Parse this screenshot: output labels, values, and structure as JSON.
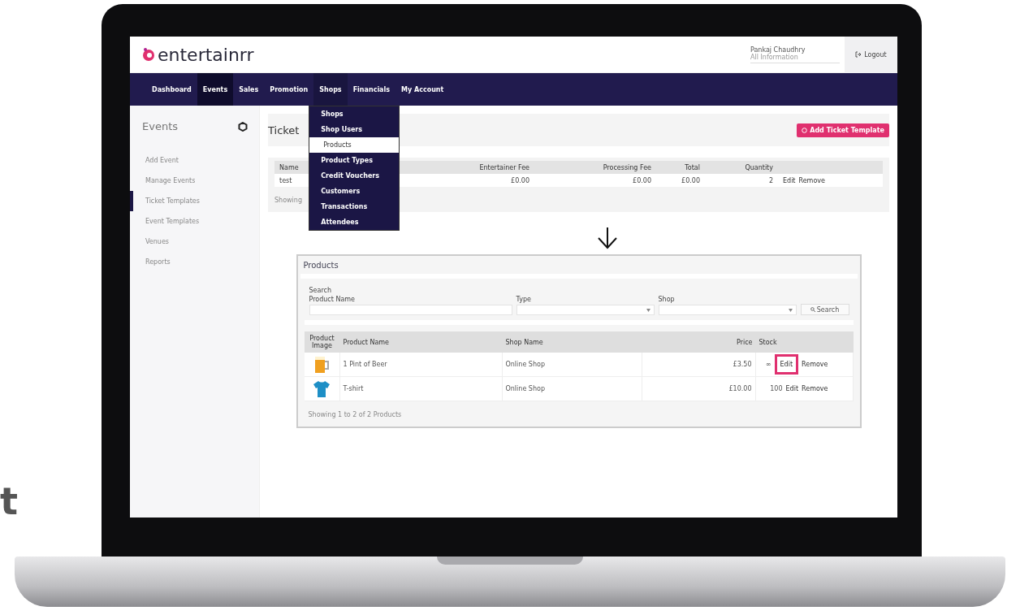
{
  "side_text": "t",
  "header": {
    "logo": "entertainrr",
    "user": {
      "name": "Pankaj Chaudhry",
      "account": "All Information"
    },
    "logout": "Logout"
  },
  "nav": [
    {
      "label": "Dashboard",
      "selected": false,
      "expanded": false
    },
    {
      "label": "Events",
      "selected": true,
      "expanded": false
    },
    {
      "label": "Sales",
      "selected": false,
      "expanded": false
    },
    {
      "label": "Promotion",
      "selected": false,
      "expanded": false
    },
    {
      "label": "Shops",
      "selected": false,
      "expanded": true
    },
    {
      "label": "Financials",
      "selected": false,
      "expanded": false
    },
    {
      "label": "My Account",
      "selected": false,
      "expanded": false
    }
  ],
  "dropdown": [
    {
      "label": "Shops",
      "selected": false
    },
    {
      "label": "Shop Users",
      "selected": false
    },
    {
      "label": "Products",
      "selected": true
    },
    {
      "label": "Product Types",
      "selected": false
    },
    {
      "label": "Credit Vouchers",
      "selected": false
    },
    {
      "label": "Customers",
      "selected": false
    },
    {
      "label": "Transactions",
      "selected": false
    },
    {
      "label": "Attendees",
      "selected": false
    }
  ],
  "sidebar": {
    "title": "Events",
    "items": [
      {
        "label": "Add Event",
        "selected": false
      },
      {
        "label": "Manage Events",
        "selected": false
      },
      {
        "label": "Ticket Templates",
        "selected": true
      },
      {
        "label": "Event Templates",
        "selected": false
      },
      {
        "label": "Venues",
        "selected": false
      },
      {
        "label": "Reports",
        "selected": false
      }
    ]
  },
  "page": {
    "title": "Ticket",
    "add_button": "Add Ticket Template",
    "table": {
      "columns": [
        "Name",
        "Entertainer Fee",
        "Processing Fee",
        "Total",
        "Quantity"
      ],
      "rows": [
        {
          "cells": [
            "test",
            "£0.00",
            "£0.00",
            "£0.00",
            "2"
          ],
          "actions": [
            "Edit",
            "Remove"
          ]
        }
      ],
      "footer": "Showing"
    }
  },
  "products": {
    "title": "Products",
    "search": {
      "heading": "Search",
      "name_label": "Product Name",
      "type_label": "Type",
      "shop_label": "Shop",
      "button": "Search"
    },
    "columns": [
      "Product Image",
      "Product Name",
      "Shop Name",
      "Price",
      "Stock"
    ],
    "rows": [
      {
        "kind": "mug",
        "name": "1 Pint of Beer",
        "shop": "Online Shop",
        "price": "£3.50",
        "stock": "∞",
        "actions": [
          {
            "label": "Edit",
            "highlighted": true
          },
          {
            "label": "Remove",
            "highlighted": false
          }
        ]
      },
      {
        "kind": "shirt",
        "name": "T-shirt",
        "shop": "Online Shop",
        "price": "£10.00",
        "stock": "100",
        "actions": [
          {
            "label": "Edit",
            "highlighted": false
          },
          {
            "label": "Remove",
            "highlighted": false
          }
        ]
      }
    ],
    "footer": "Showing 1 to 2 of 2 Products"
  }
}
